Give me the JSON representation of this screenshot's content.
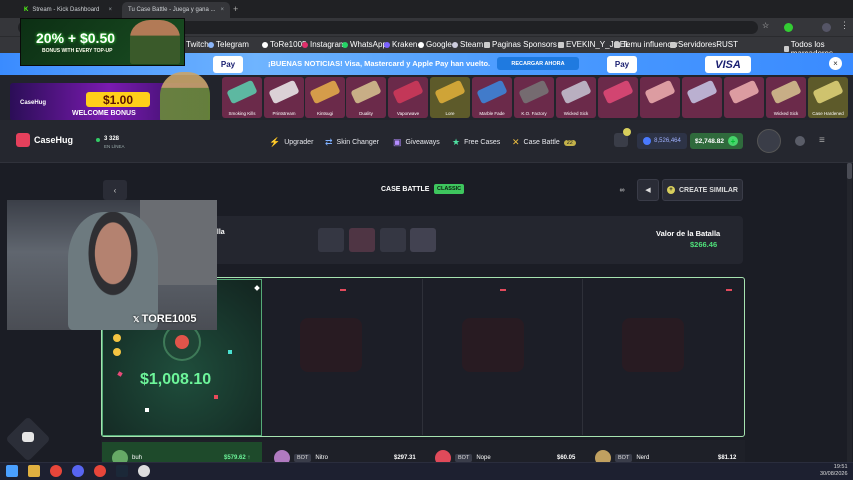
{
  "browser": {
    "tabs": [
      {
        "label": "Stream - Kick Dashboard"
      },
      {
        "label": "Tu Case Battle - Juega y gana ..."
      }
    ],
    "url_partial": "attle",
    "bookmarks": [
      "Twitch",
      "Telegram",
      "ToRe1005",
      "Instagram",
      "WhatsApp",
      "Kraken",
      "Google",
      "Steam",
      "Paginas Sponsors",
      "EVEKIN_Y_JOEL",
      "Temu influencer",
      "ServidoresRUST",
      "Todos los marcadores"
    ]
  },
  "gift_overlay": {
    "amount": "20% + $0.50",
    "subtitle": "BONUS WITH EVERY TOP-UP"
  },
  "promo": {
    "message": "¡BUENAS NOTICIAS! Visa, Mastercard y Apple Pay han vuelto.",
    "button": "RECARGAR AHORA",
    "cards": [
      "Pay",
      "Pay",
      "VISA"
    ]
  },
  "welcome": {
    "amount": "$1.00",
    "label": "WELCOME BONUS",
    "brand": "CaseHug"
  },
  "drops": [
    "Smoking Kills",
    "Printstream",
    "Kintsugi",
    "Duality",
    "Vaporwave",
    "Lore",
    "Marble Fade",
    "K.O. Factory",
    "Wicked Sick",
    "",
    "",
    "",
    "",
    "Wicked Sick",
    "Case Hardened"
  ],
  "header": {
    "logo": "CaseHug",
    "online_count": "3 328",
    "online_label": "EN LÍNEA",
    "nav": [
      "Upgrader",
      "Skin Changer",
      "Giveaways",
      "Free Cases",
      "Case Battle"
    ],
    "case_battle_count": "22",
    "balance_coins": "8,526,464",
    "balance_usd": "$2,748.82"
  },
  "battle": {
    "title": "CASE BATTLE",
    "mode": "CLASSIC",
    "create_label": "CREATE SIMILAR",
    "batalla_label": "alla",
    "value_label": "Valor de la Batalla",
    "value_amount": "$266.46",
    "winner_amount": "$1,008.10",
    "players": [
      {
        "name": "buh",
        "amount": "$579.62 ↑",
        "bot": false
      },
      {
        "name": "Nitro",
        "amount": "$297.31",
        "bot": true
      },
      {
        "name": "Nope",
        "amount": "$60.05",
        "bot": true
      },
      {
        "name": "Nerd",
        "amount": "$81.12",
        "bot": true
      }
    ],
    "bot_label": "BOT"
  },
  "webcam": {
    "handle": "TORE1005"
  },
  "taskbar": {
    "time": "19:51",
    "date": "30/08/2026"
  }
}
